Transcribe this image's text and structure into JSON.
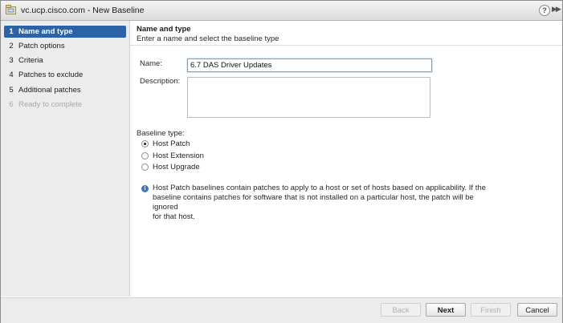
{
  "window": {
    "title": "vc.ucp.cisco.com - New Baseline"
  },
  "steps": [
    {
      "num": "1",
      "label": "Name and type"
    },
    {
      "num": "2",
      "label": "Patch options"
    },
    {
      "num": "3",
      "label": "Criteria"
    },
    {
      "num": "4",
      "label": "Patches to exclude"
    },
    {
      "num": "5",
      "label": "Additional patches"
    },
    {
      "num": "6",
      "label": "Ready to complete"
    }
  ],
  "header": {
    "title": "Name and type",
    "subtitle": "Enter a name and select the baseline type"
  },
  "form": {
    "name_label": "Name:",
    "name_value": "6.7 DAS Driver Updates",
    "description_label": "Description:",
    "description_value": ""
  },
  "baseline_type": {
    "label": "Baseline type:",
    "options": [
      "Host Patch",
      "Host Extension",
      "Host Upgrade"
    ],
    "selected": "Host Patch"
  },
  "info": {
    "line1": "Host Patch baselines contain patches to apply to a host or set of hosts based on applicability. If the",
    "line2": "baseline contains patches for software that is not installed on a particular host, the patch will be ignored",
    "line3": "for that host."
  },
  "footer": {
    "back": "Back",
    "next": "Next",
    "finish": "Finish",
    "cancel": "Cancel"
  },
  "icons": {
    "title": "vsphere-window-icon",
    "help": "help-icon",
    "expand": "double-chevron-right-icon",
    "info": "info-icon"
  },
  "colors": {
    "active_step": "#2c63a7",
    "sidebar_bg": "#ececec",
    "input_focus": "#6aa6d6",
    "info_icon": "#3a78c2"
  }
}
